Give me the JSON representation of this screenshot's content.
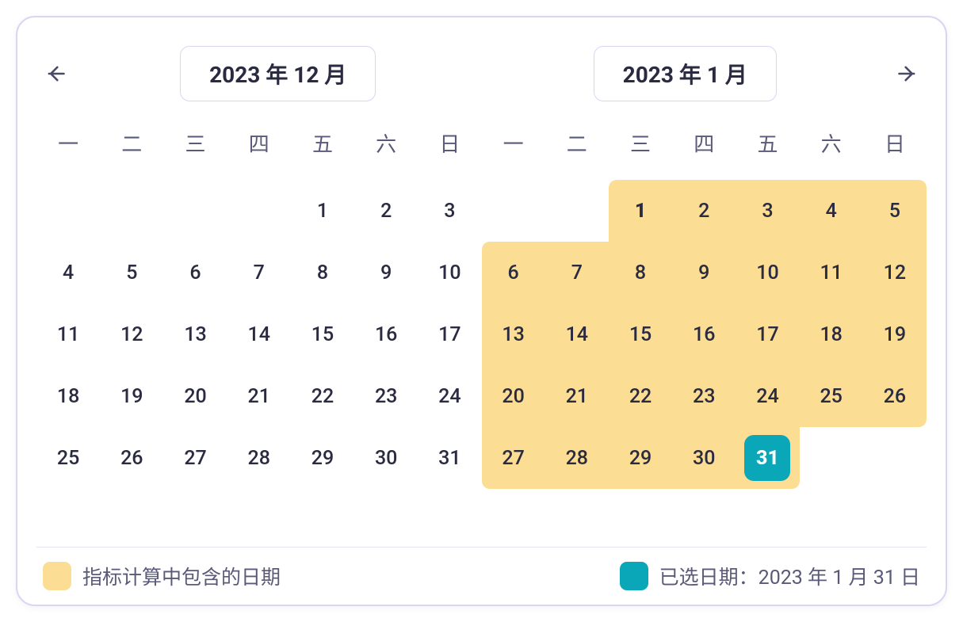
{
  "header": {
    "left_month_label": "2023 年 12 月",
    "right_month_label": "2023 年 1 月"
  },
  "weekdays": [
    "一",
    "二",
    "三",
    "四",
    "五",
    "六",
    "日"
  ],
  "left_month": {
    "blanks_before": 4,
    "days": [
      1,
      2,
      3,
      4,
      5,
      6,
      7,
      8,
      9,
      10,
      11,
      12,
      13,
      14,
      15,
      16,
      17,
      18,
      19,
      20,
      21,
      22,
      23,
      24,
      25,
      26,
      27,
      28,
      29,
      30,
      31
    ]
  },
  "right_month": {
    "blanks_before": 2,
    "days": [
      1,
      2,
      3,
      4,
      5,
      6,
      7,
      8,
      9,
      10,
      11,
      12,
      13,
      14,
      15,
      16,
      17,
      18,
      19,
      20,
      21,
      22,
      23,
      24,
      25,
      26,
      27,
      28,
      29,
      30,
      31
    ],
    "included_range": {
      "start": 1,
      "end": 31
    },
    "bold_day": 1,
    "selected_day": 31
  },
  "legend": {
    "included_label": "指标计算中包含的日期",
    "selected_label": "已选日期：2023 年 1 月 31 日"
  },
  "colors": {
    "included": "#fbdd94",
    "selected": "#0aa7b8"
  }
}
